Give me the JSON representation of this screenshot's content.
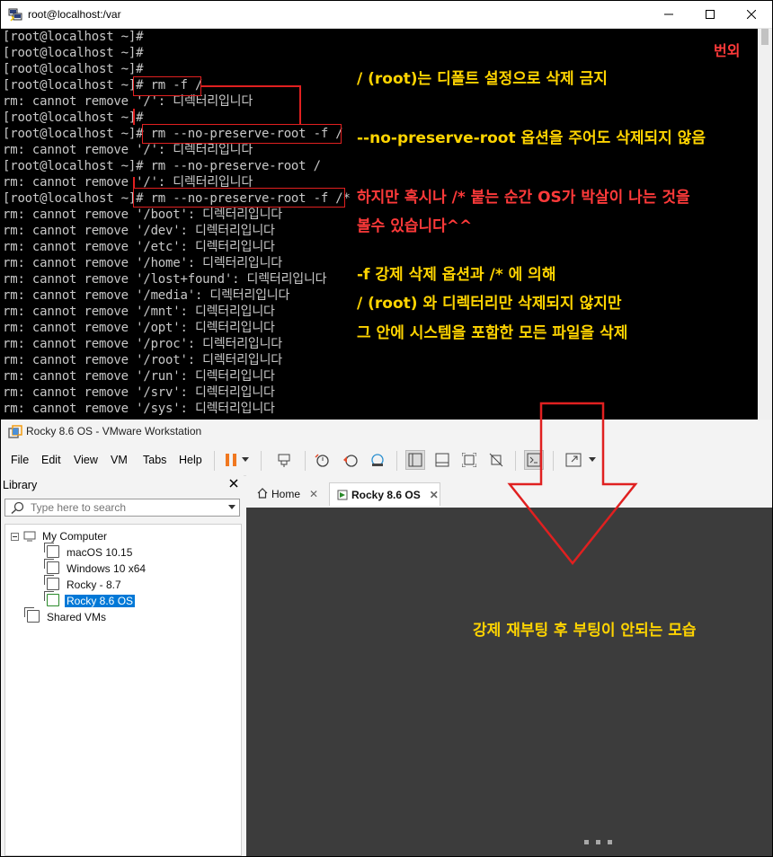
{
  "terminal": {
    "title": "root@localhost:/var",
    "lines": [
      "[root@localhost ~]#",
      "[root@localhost ~]#",
      "[root@localhost ~]#",
      "[root@localhost ~]# rm -f /",
      "rm: cannot remove '/': 디렉터리입니다",
      "[root@localhost ~]#",
      "[root@localhost ~]# rm --no-preserve-root -f /",
      "rm: cannot remove '/': 디렉터리입니다",
      "[root@localhost ~]# rm --no-preserve-root /",
      "rm: cannot remove '/': 디렉터리입니다",
      "[root@localhost ~]# rm --no-preserve-root -f /*",
      "rm: cannot remove '/boot': 디렉터리입니다",
      "rm: cannot remove '/dev': 디렉터리입니다",
      "rm: cannot remove '/etc': 디렉터리입니다",
      "rm: cannot remove '/home': 디렉터리입니다",
      "rm: cannot remove '/lost+found': 디렉터리입니다",
      "rm: cannot remove '/media': 디렉터리입니다",
      "rm: cannot remove '/mnt': 디렉터리입니다",
      "rm: cannot remove '/opt': 디렉터리입니다",
      "rm: cannot remove '/proc': 디렉터리입니다",
      "rm: cannot remove '/root': 디렉터리입니다",
      "rm: cannot remove '/run': 디렉터리입니다",
      "rm: cannot remove '/srv': 디렉터리입니다",
      "rm: cannot remove '/sys': 디렉터리입니다"
    ]
  },
  "annotations": {
    "extra": "번외",
    "note1": "/ (root)는 디폴트 설정으로 삭제 금지",
    "note2": "--no-preserve-root 옵션을 주어도 삭제되지 않음",
    "note3a": "하지만 혹시나 /* 붙는 순간 OS가 박살이 나는 것을",
    "note3b": "볼수 있습니다^^",
    "note4a": "-f 강제 삭제 옵션과 /* 에 의해",
    "note4b": "/ (root) 와 디렉터리만 삭제되지 않지만",
    "note4c": "그 안에 시스템을 포함한 모든 파일을 삭제",
    "note5": "강제 재부팅 후 부팅이 안되는 모습"
  },
  "vmware": {
    "title": "Rocky 8.6 OS - VMware Workstation",
    "menu": [
      "File",
      "Edit",
      "View",
      "VM",
      "Tabs",
      "Help"
    ],
    "library": {
      "header": "Library",
      "search_placeholder": "Type here to search",
      "root": "My Computer",
      "vms": [
        "macOS 10.15",
        "Windows 10 x64",
        "Rocky - 8.7",
        "Rocky 8.6 OS"
      ],
      "shared": "Shared VMs"
    },
    "tabs": [
      "Home",
      "Rocky 8.6 OS"
    ]
  },
  "colors": {
    "annotation_yellow": "#ffd400",
    "annotation_red": "#ff3a3a",
    "highlight_red": "#e02020",
    "selection_blue": "#0078d7"
  }
}
